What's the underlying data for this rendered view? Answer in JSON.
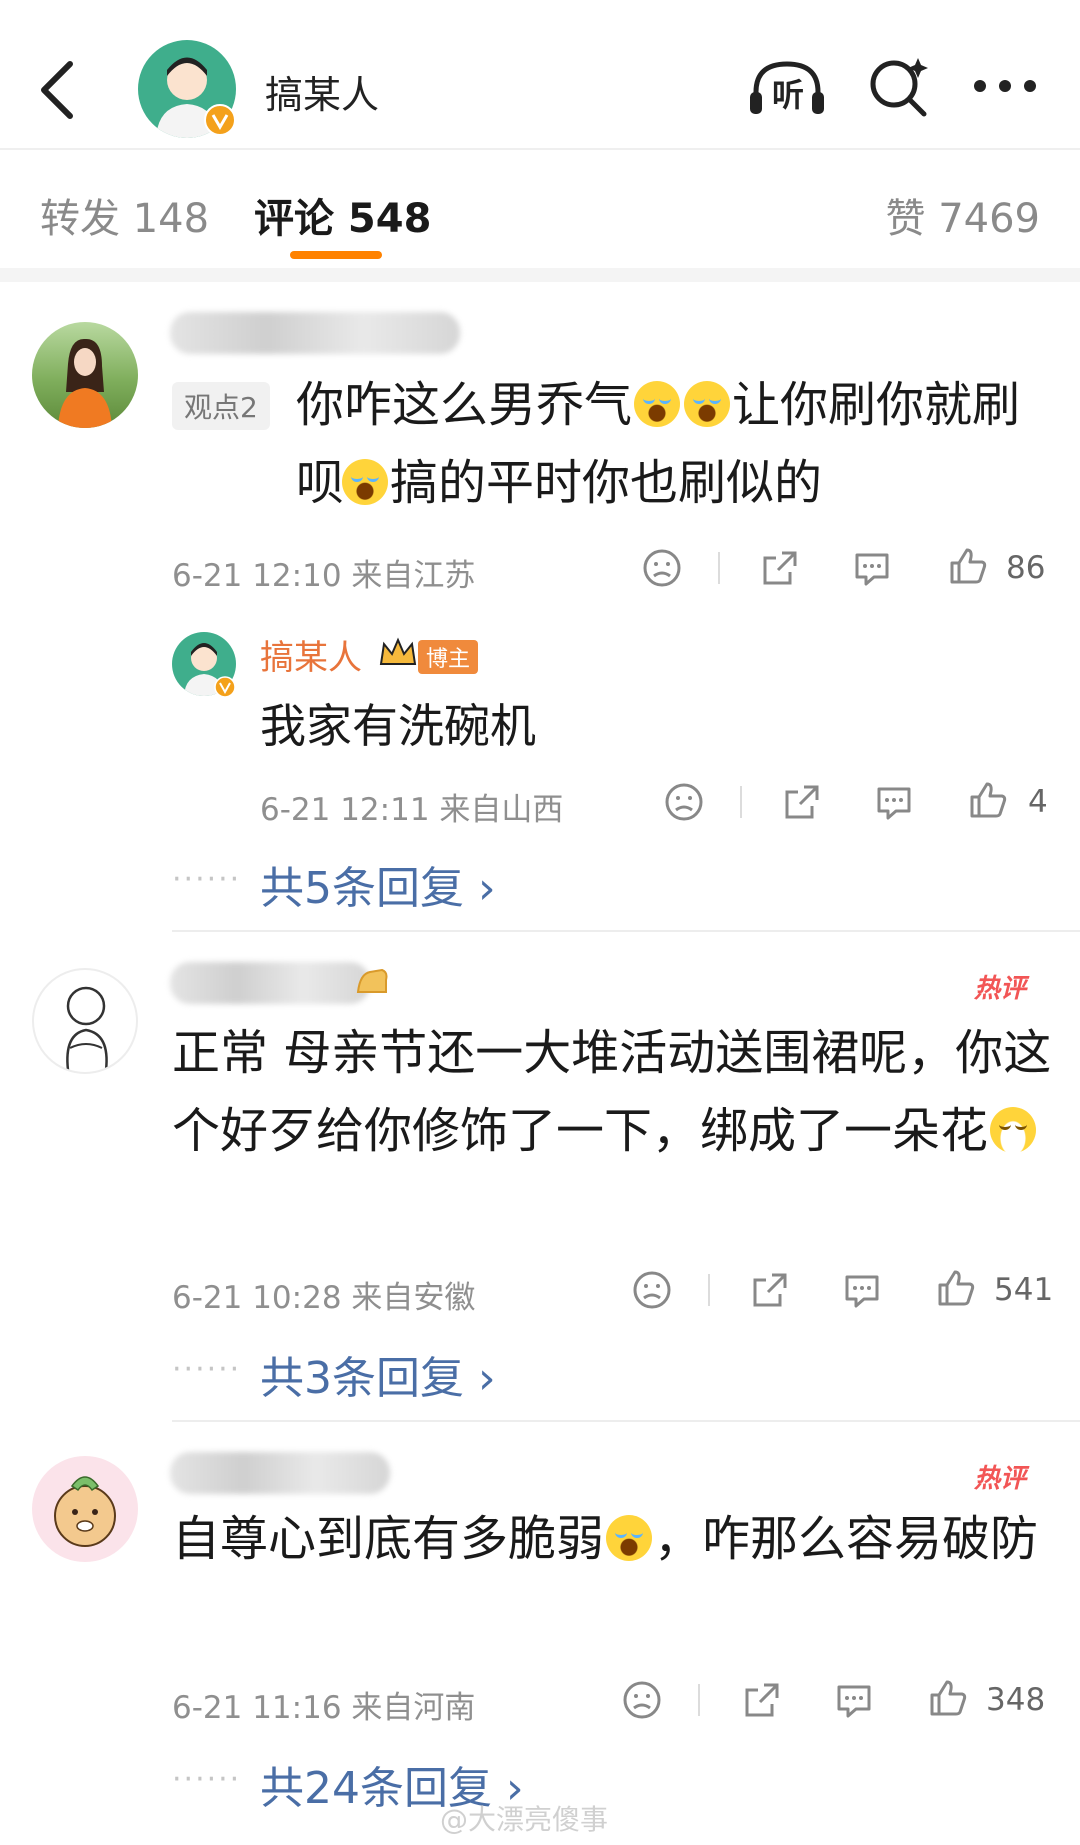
{
  "header": {
    "author_name": "搞某人",
    "icons": [
      "back-icon",
      "listen-icon",
      "search-icon",
      "more-icon"
    ],
    "listen_label": "听"
  },
  "tabs": {
    "repost": "转发 148",
    "comments": "评论 548",
    "likes": "赞 7469"
  },
  "comments": [
    {
      "tag": "观点2",
      "text_parts": [
        "你咋这么男乔气",
        "让你刷你就刷呗",
        "搞的平时你也刷似的"
      ],
      "time_location": "6-21 12:10  来自江苏",
      "likes": "86",
      "reply": {
        "author": "搞某人",
        "badge": "博主",
        "text": "我家有洗碗机",
        "time_location": "6-21 12:11  来自山西",
        "likes": "4"
      },
      "more_replies": "共5条回复 ›"
    },
    {
      "hot_badge": "热评",
      "text_parts": [
        "正常 母亲节还一大堆活动送围裙呢，你这个好歹给你修饰了一下，绑成了一朵花"
      ],
      "time_location": "6-21 10:28  来自安徽",
      "likes": "541",
      "more_replies": "共3条回复 ›"
    },
    {
      "hot_badge": "热评",
      "text_parts": [
        "自尊心到底有多脆弱",
        "，咋那么容易破防"
      ],
      "time_location": "6-21 11:16  来自河南",
      "likes": "348",
      "more_replies": "共24条回复 ›"
    }
  ],
  "more_dots": "······",
  "watermark": "@大漂亮傻事",
  "colors": {
    "accent": "#ff8200",
    "link": "#4a6ea6",
    "hot": "#f25555",
    "blogger": "#e8743b"
  }
}
